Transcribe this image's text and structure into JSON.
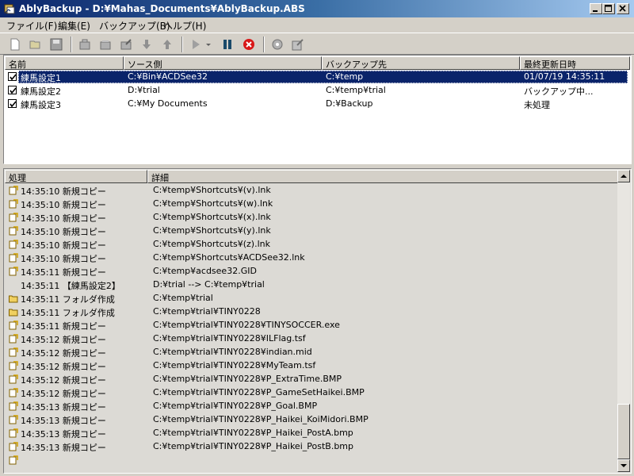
{
  "window": {
    "title": "AblyBackup - D:¥Mahas_Documents¥AblyBackup.ABS",
    "titlebar_colors": [
      "#0a246a",
      "#a6caf0"
    ]
  },
  "menu": [
    {
      "label": "ファイル(F)"
    },
    {
      "label": "編集(E)"
    },
    {
      "label": "バックアップ(B)"
    },
    {
      "label": "ヘルプ(H)"
    }
  ],
  "toolbar": {
    "icons": [
      "new-file-icon",
      "open-folder-icon",
      "save-icon",
      "delete-item-icon",
      "add-item-icon",
      "edit-item-icon",
      "move-down-icon",
      "move-up-icon",
      "play-icon",
      "dropdown-arrow-icon",
      "pause-icon",
      "stop-icon",
      "settings-icon",
      "properties-icon"
    ]
  },
  "sets": {
    "columns": [
      "名前",
      "ソース側",
      "バックアップ先",
      "最終更新日時"
    ],
    "rows": [
      {
        "checked": true,
        "name": "練馬設定1",
        "source": "C:¥Bin¥ACDSee32",
        "dest": "C:¥temp",
        "updated": "01/07/19 14:35:11",
        "selected": true
      },
      {
        "checked": true,
        "name": "練馬設定2",
        "source": "D:¥trial",
        "dest": "C:¥temp¥trial",
        "updated": "バックアップ中...",
        "selected": false
      },
      {
        "checked": true,
        "name": "練馬設定3",
        "source": "C:¥My Documents",
        "dest": "D:¥Backup",
        "updated": "未処理",
        "selected": false
      }
    ]
  },
  "log": {
    "columns": [
      "処理",
      "詳細"
    ],
    "rows": [
      {
        "icon": "new-copy-icon",
        "action": "14:35:10 新規コピー",
        "detail": "C:¥temp¥Shortcuts¥(v).lnk"
      },
      {
        "icon": "new-copy-icon",
        "action": "14:35:10 新規コピー",
        "detail": "C:¥temp¥Shortcuts¥(w).lnk"
      },
      {
        "icon": "new-copy-icon",
        "action": "14:35:10 新規コピー",
        "detail": "C:¥temp¥Shortcuts¥(x).lnk"
      },
      {
        "icon": "new-copy-icon",
        "action": "14:35:10 新規コピー",
        "detail": "C:¥temp¥Shortcuts¥(y).lnk"
      },
      {
        "icon": "new-copy-icon",
        "action": "14:35:10 新規コピー",
        "detail": "C:¥temp¥Shortcuts¥(z).lnk"
      },
      {
        "icon": "new-copy-icon",
        "action": "14:35:10 新規コピー",
        "detail": "C:¥temp¥Shortcuts¥ACDSee32.lnk"
      },
      {
        "icon": "new-copy-icon",
        "action": "14:35:11 新規コピー",
        "detail": "C:¥temp¥acdsee32.GID"
      },
      {
        "icon": "",
        "action": "14:35:11 【練馬設定2】",
        "detail": "D:¥trial --> C:¥temp¥trial"
      },
      {
        "icon": "folder-create-icon",
        "action": "14:35:11 フォルダ作成",
        "detail": "C:¥temp¥trial"
      },
      {
        "icon": "folder-create-icon",
        "action": "14:35:11 フォルダ作成",
        "detail": "C:¥temp¥trial¥TINY0228"
      },
      {
        "icon": "new-copy-icon",
        "action": "14:35:11 新規コピー",
        "detail": "C:¥temp¥trial¥TINY0228¥TINYSOCCER.exe"
      },
      {
        "icon": "new-copy-icon",
        "action": "14:35:12 新規コピー",
        "detail": "C:¥temp¥trial¥TINY0228¥ILFlag.tsf"
      },
      {
        "icon": "new-copy-icon",
        "action": "14:35:12 新規コピー",
        "detail": "C:¥temp¥trial¥TINY0228¥indian.mid"
      },
      {
        "icon": "new-copy-icon",
        "action": "14:35:12 新規コピー",
        "detail": "C:¥temp¥trial¥TINY0228¥MyTeam.tsf"
      },
      {
        "icon": "new-copy-icon",
        "action": "14:35:12 新規コピー",
        "detail": "C:¥temp¥trial¥TINY0228¥P_ExtraTime.BMP"
      },
      {
        "icon": "new-copy-icon",
        "action": "14:35:12 新規コピー",
        "detail": "C:¥temp¥trial¥TINY0228¥P_GameSetHaikei.BMP"
      },
      {
        "icon": "new-copy-icon",
        "action": "14:35:13 新規コピー",
        "detail": "C:¥temp¥trial¥TINY0228¥P_Goal.BMP"
      },
      {
        "icon": "new-copy-icon",
        "action": "14:35:13 新規コピー",
        "detail": "C:¥temp¥trial¥TINY0228¥P_Haikei_KoiMidori.BMP"
      },
      {
        "icon": "new-copy-icon",
        "action": "14:35:13 新規コピー",
        "detail": "C:¥temp¥trial¥TINY0228¥P_Haikei_PostA.bmp"
      },
      {
        "icon": "new-copy-icon",
        "action": "14:35:13 新規コピー",
        "detail": "C:¥temp¥trial¥TINY0228¥P_Haikei_PostB.bmp"
      },
      {
        "icon": "new-copy-icon",
        "action": "",
        "detail": ""
      }
    ]
  },
  "colors": {
    "selection": "#0a246a",
    "chrome": "#d4d0c8"
  }
}
